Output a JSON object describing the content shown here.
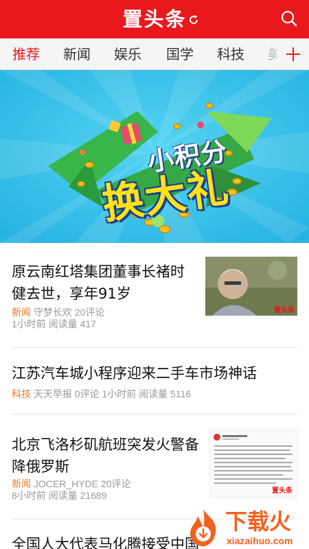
{
  "header": {
    "logo_text": "置头条",
    "brand_color": "#e8181d",
    "refresh_icon": "refresh-icon",
    "search_icon": "search-icon"
  },
  "tabs": {
    "items": [
      {
        "label": "推荐",
        "active": true
      },
      {
        "label": "新闻",
        "active": false
      },
      {
        "label": "娱乐",
        "active": false
      },
      {
        "label": "国学",
        "active": false
      },
      {
        "label": "科技",
        "active": false
      },
      {
        "label": "美",
        "active": false
      }
    ],
    "add_icon": "plus-icon"
  },
  "banner": {
    "line1": "小积分",
    "line2": "换大礼"
  },
  "feed": [
    {
      "title": "原云南红塔集团董事长褚时健去世，享年91岁",
      "category": "新闻",
      "source": "守梦长欢",
      "comments": "20评论",
      "time": "1小时前",
      "reads": "阅读量 417",
      "thumbnail_caption": "置头条"
    },
    {
      "title": "江苏汽车城小程序迎来二手车市场神话",
      "category": "科技",
      "source": "天天早报",
      "comments": "0评论",
      "time": "1小时前",
      "reads": "阅读量 5116"
    },
    {
      "title": "北京飞洛杉矶航班突发火警备降俄罗斯",
      "category": "新闻",
      "source": "JOCER_HYDE",
      "comments": "20评论",
      "time": "8小时前",
      "reads": "阅读量 21689",
      "thumbnail_caption": "置头条"
    },
    {
      "title": "全国人大代表马化腾接受中国"
    }
  ],
  "watermark": {
    "text": "下载火",
    "url_text": "xiazaihuo.com"
  }
}
